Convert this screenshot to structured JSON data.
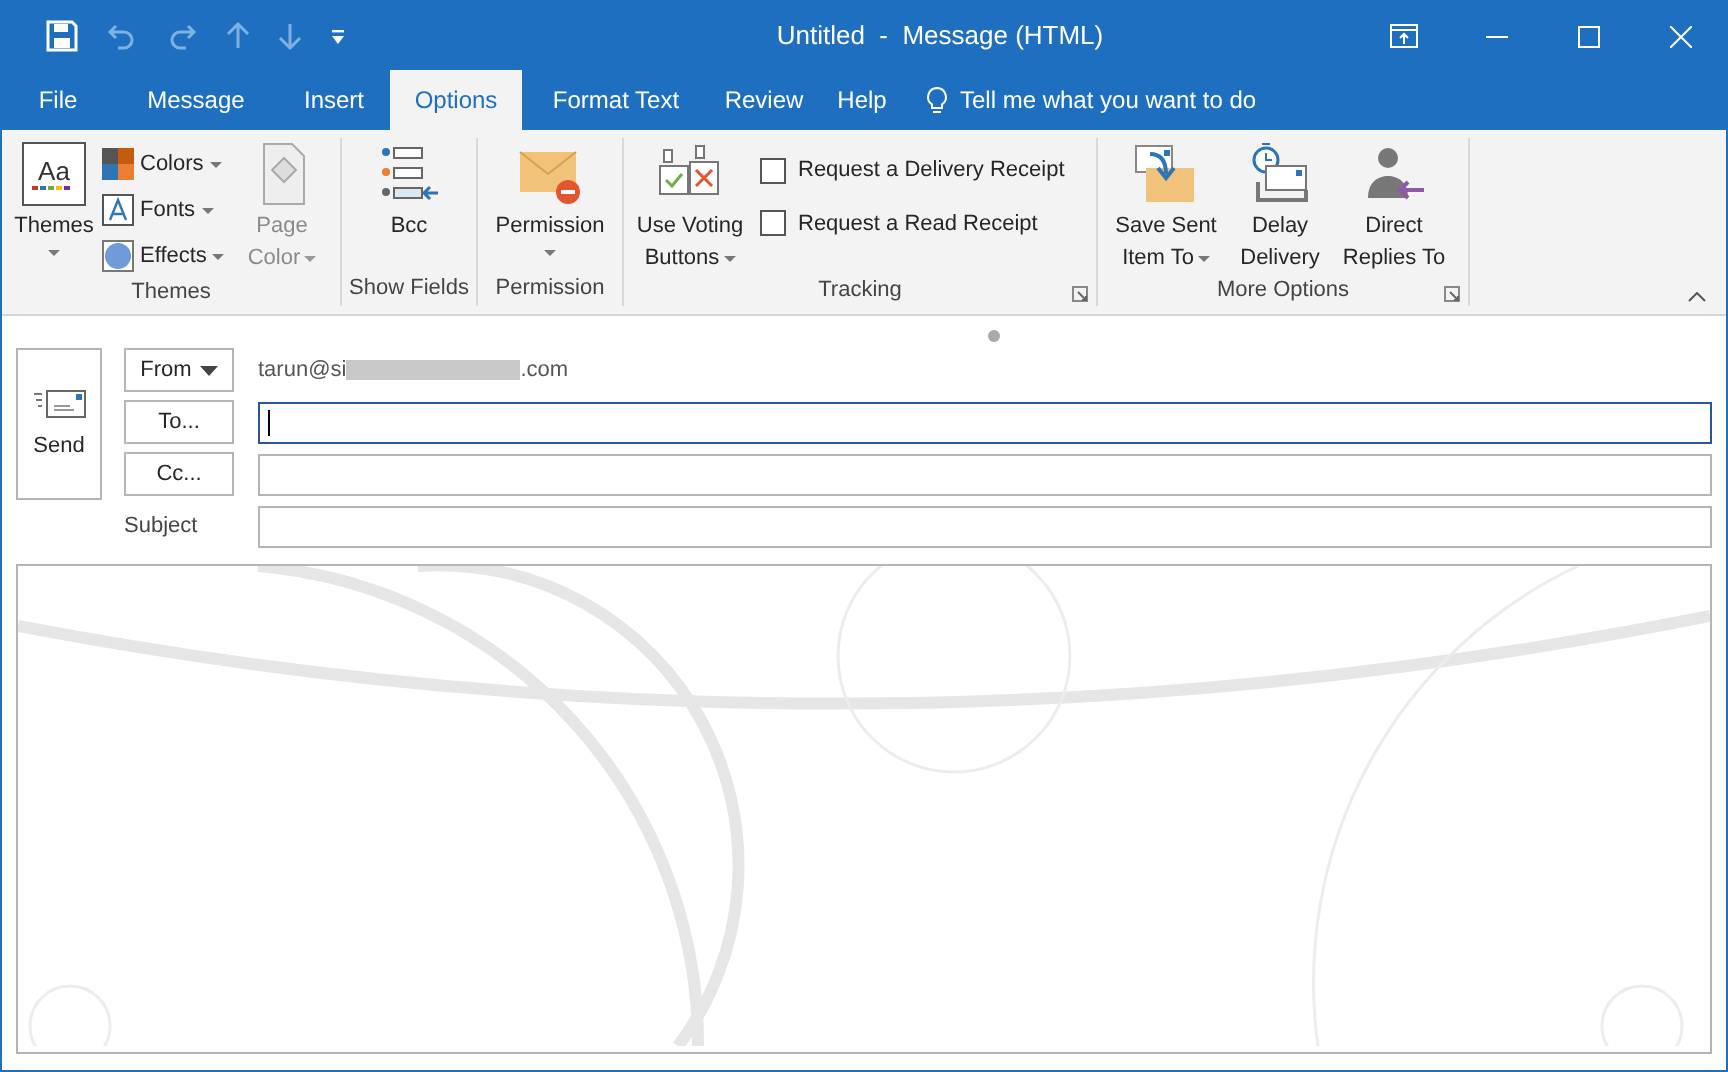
{
  "window": {
    "title": "Untitled  -  Message (HTML)"
  },
  "menu_tabs": [
    {
      "label": "File",
      "selected": false
    },
    {
      "label": "Message",
      "selected": false
    },
    {
      "label": "Insert",
      "selected": false
    },
    {
      "label": "Options",
      "selected": true
    },
    {
      "label": "Format Text",
      "selected": false
    },
    {
      "label": "Review",
      "selected": false
    },
    {
      "label": "Help",
      "selected": false
    }
  ],
  "tell_me": {
    "placeholder": "Tell me what you want to do"
  },
  "ribbon": {
    "groups": [
      {
        "label": "Themes",
        "launcher": false
      },
      {
        "label": "Show Fields",
        "launcher": false
      },
      {
        "label": "Permission",
        "launcher": false
      },
      {
        "label": "Tracking",
        "launcher": true
      },
      {
        "label": "More Options",
        "launcher": true
      }
    ],
    "themes": {
      "label": "Themes",
      "icon_text": "Aa",
      "small": [
        {
          "label": "Colors"
        },
        {
          "label": "Fonts"
        },
        {
          "label": "Effects"
        }
      ],
      "page_color": {
        "label": "Page Color",
        "disabled": true
      }
    },
    "bcc": {
      "label": "Bcc"
    },
    "permission": {
      "label": "Permission"
    },
    "voting": {
      "label": "Use Voting Buttons"
    },
    "tracking": [
      {
        "label": "Request a Delivery Receipt",
        "checked": false
      },
      {
        "label": "Request a Read Receipt",
        "checked": false
      }
    ],
    "more_options": [
      {
        "label": "Save Sent Item To"
      },
      {
        "label": "Delay Delivery"
      },
      {
        "label": "Direct Replies To"
      }
    ]
  },
  "compose": {
    "send": "Send",
    "from": {
      "label": "From",
      "address_start": "tarun@si",
      "address_end": ".com"
    },
    "to": {
      "label": "To..."
    },
    "cc": {
      "label": "Cc..."
    },
    "subject": {
      "label": "Subject"
    }
  }
}
